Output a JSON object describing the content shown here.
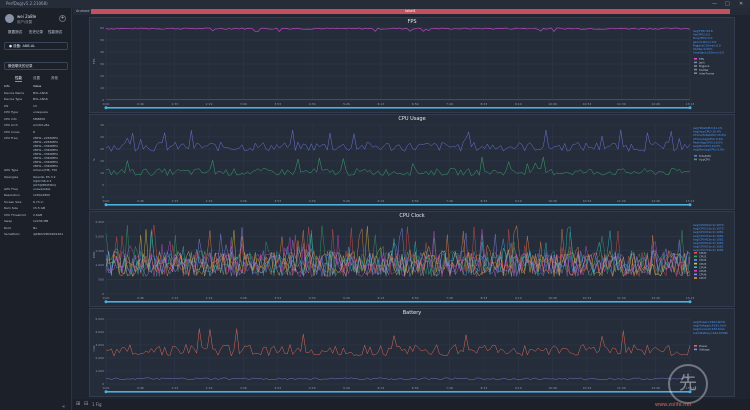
{
  "window": {
    "title": "PerfDog(v5.2.21068)",
    "controls": [
      "—",
      "□",
      "✕"
    ]
  },
  "sidebar": {
    "user_name": "wei 2a8le",
    "user_sub": "用户/设置",
    "add_icon": "+",
    "tabs_row1": [
      {
        "label": "数据测试"
      },
      {
        "label": "历史记录"
      },
      {
        "label": "性能测试"
      }
    ],
    "device": "● 设备: ANE-AL",
    "app": "微信聊天的记录",
    "tabs_row2": [
      {
        "label": "性能"
      },
      {
        "label": "设置"
      },
      {
        "label": "其他"
      }
    ],
    "info_header": {
      "k": "Info",
      "v": "Value"
    },
    "info": [
      {
        "k": "Device Name",
        "v": "BVL-AN16"
      },
      {
        "k": "Device Type",
        "v": "BVL-AN16"
      },
      {
        "k": "OS",
        "v": "13"
      },
      {
        "k": "CPU Type",
        "v": "unisquare"
      },
      {
        "k": "CPU Info",
        "v": "SM8650"
      },
      {
        "k": "CPU Arch",
        "v": "arm64-v8a"
      },
      {
        "k": "CPU Cores",
        "v": "8"
      },
      {
        "k": "CPU Freq",
        "v": "2MHz~2265MHz\n2MHz~2265MHz\n2MHz~3360MHz\n2MHz~3360MHz\n2MHz~3360MHz\n2MHz~3360MHz\n2MHz~3360MHz\n2MHz~3360MHz"
      },
      {
        "k": "GPU Type",
        "v": "Adreno(TM) 750"
      },
      {
        "k": "Opengles",
        "v": "OpenGL ES 3.2\nV@0746.0.3\n(GIT@88dfd6d)"
      },
      {
        "k": "GPU Freq",
        "v": "unavailable"
      },
      {
        "k": "Resolution",
        "v": "1264x2800"
      },
      {
        "k": "Screen Size",
        "v": "6.73 in"
      },
      {
        "k": "Ram Size",
        "v": "15.5 GB"
      },
      {
        "k": "CPU Threshold",
        "v": "2.6GB"
      },
      {
        "k": "Swap",
        "v": "12236 MB"
      },
      {
        "k": "Root",
        "v": "No"
      },
      {
        "k": "SerialNum",
        "v": "4J0NX22B29001461"
      }
    ],
    "footer_icon": "«"
  },
  "main": {
    "strip_label": "Android",
    "banner": "label1",
    "bottom_items": [
      "⊞",
      "⊟",
      "1 Fig"
    ]
  },
  "colors": {
    "fps": "#d34bd0",
    "cpu_total": "#6b75d6",
    "cpu_app": "#3aa36a",
    "clock": [
      "#e5534b",
      "#3aa36a",
      "#5aa0e6",
      "#e0c04a",
      "#3ac0c0",
      "#d34bd0",
      "#8a8af0",
      "#f08a4a"
    ],
    "battery": "#e06a55",
    "battery2": "#8a8af0",
    "scrollbar": "#4ab0e0",
    "grid": "#344055"
  },
  "time_ticks": [
    "0:00",
    "0:46",
    "1:33",
    "2:19",
    "3:06",
    "3:53",
    "4:39",
    "5:26",
    "6:13",
    "6:59",
    "7:46",
    "8:33",
    "9:19",
    "10:06",
    "10:53",
    "11:39",
    "12:26",
    "13:13"
  ],
  "charts": [
    {
      "id": "fps",
      "title": "FPS",
      "ylabel": "FPS",
      "ymax": 60,
      "yticks": [
        "0",
        "10",
        "20",
        "30",
        "40",
        "50",
        "60"
      ],
      "legend": [
        "FPS",
        "Jank",
        "BigJank",
        "Stutter",
        "InterFrame"
      ],
      "stats": [
        "Avg(FPS):59.8",
        "Var(FPS):0.5",
        "Drop(FPS):0.0",
        "Jank(/10min):0.0",
        "BigJank(/10min):0.0",
        "Stutter:0.00%",
        "SmallJank(/10min):0.0"
      ]
    },
    {
      "id": "cpu",
      "title": "CPU Usage",
      "ylabel": "%",
      "ymax": 30,
      "yticks": [
        "0",
        "5",
        "10",
        "15",
        "20",
        "25",
        "30"
      ],
      "legend": [
        "TotalCPU",
        "AppCPU"
      ],
      "stats": [
        "Avg(TotalCPU):21.1%",
        "Avg(AppCPU):10.4%",
        "CTime(TotalCPU):20.6%",
        "CTime(AppCPU):0.6%",
        "Peak(AppCPU):18.0%",
        "Avg(NmCPU):20.0%",
        "Avg(NmAppCPU):9.9%"
      ]
    },
    {
      "id": "clock",
      "title": "CPU Clock",
      "ylabel": "MHz",
      "ymax": 2500,
      "yticks": [
        "0",
        "500",
        "1,000",
        "1,500",
        "2,000",
        "2,500"
      ],
      "legend": [
        "CPU0",
        "CPU1",
        "CPU2",
        "CPU3",
        "CPU4",
        "CPU5",
        "CPU6",
        "CPU7"
      ],
      "stats": [
        "Avg(CPU0Clock):1070",
        "Avg(CPU1Clock):1070",
        "Avg(CPU2Clock):1081",
        "Avg(CPU3Clock):1081",
        "Avg(CPU4Clock):1081",
        "Avg(CPU5Clock):1081",
        "Avg(CPU6Clock):1081",
        "Avg(CPU7Clock):1081"
      ]
    },
    {
      "id": "battery",
      "title": "Battery",
      "ylabel": "mW",
      "ymax": 5000,
      "yticks": [
        "0",
        "1,000",
        "2,000",
        "3,000",
        "4,000",
        "5,000"
      ],
      "legend": [
        "Power",
        "Voltage"
      ],
      "stats": [
        "Avg(Power):1902.6mW",
        "Avg(Voltage):4193.3mV",
        "Avg(Current):453.6mA",
        "Sum(Battery):444.6mWh"
      ]
    }
  ],
  "watermark": {
    "glyph": "先",
    "text": "www.zolife.net"
  }
}
